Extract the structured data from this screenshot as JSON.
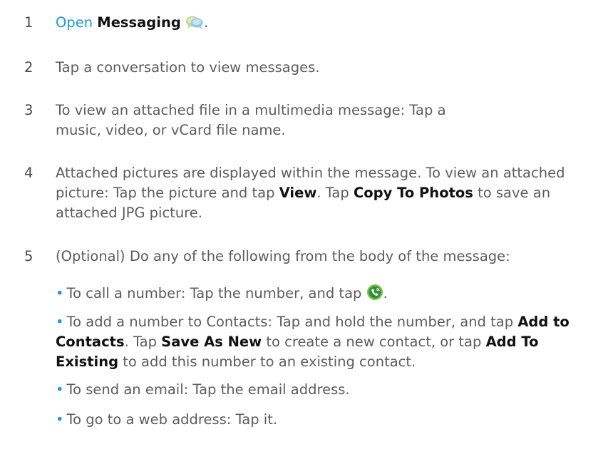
{
  "steps": [
    {
      "number": "1",
      "link": "Open",
      "bold": "Messaging",
      "end": "."
    },
    {
      "number": "2",
      "text": "Tap a conversation to view messages."
    },
    {
      "number": "3",
      "text": "To view an attached file in a multimedia message: Tap a music, video, or vCard file name."
    },
    {
      "number": "4",
      "text_a": "Attached pictures are displayed within the message. To view an attached picture: Tap the picture and tap ",
      "bold_a": "View",
      "text_b": ". Tap ",
      "bold_b": "Copy To Photos",
      "text_c": " to save an attached JPG picture."
    },
    {
      "number": "5",
      "text": "(Optional) Do any of the following from the body of the message:"
    }
  ],
  "bullets": {
    "marker": "•",
    "b1": {
      "text": "To call a number: Tap the number, and tap ",
      "end": "."
    },
    "b2": {
      "text_a": "To add a number to Contacts: Tap and hold the number, and tap ",
      "bold_a": "Add to Contacts",
      "text_b": ". Tap ",
      "bold_b": "Save As New",
      "text_c": " to create a new contact, or tap ",
      "bold_c": "Add To Existing",
      "text_d": " to add this number to an existing contact."
    },
    "b3": {
      "text": "To send an email: Tap the email address."
    },
    "b4": {
      "text": "To go to a web address: Tap it."
    }
  },
  "icons": {
    "messaging": "messaging-bubbles-icon",
    "phone": "phone-call-icon"
  },
  "colors": {
    "link": "#1a9ad6",
    "body_text": "#5c5c5c",
    "bold_text": "#111111"
  }
}
